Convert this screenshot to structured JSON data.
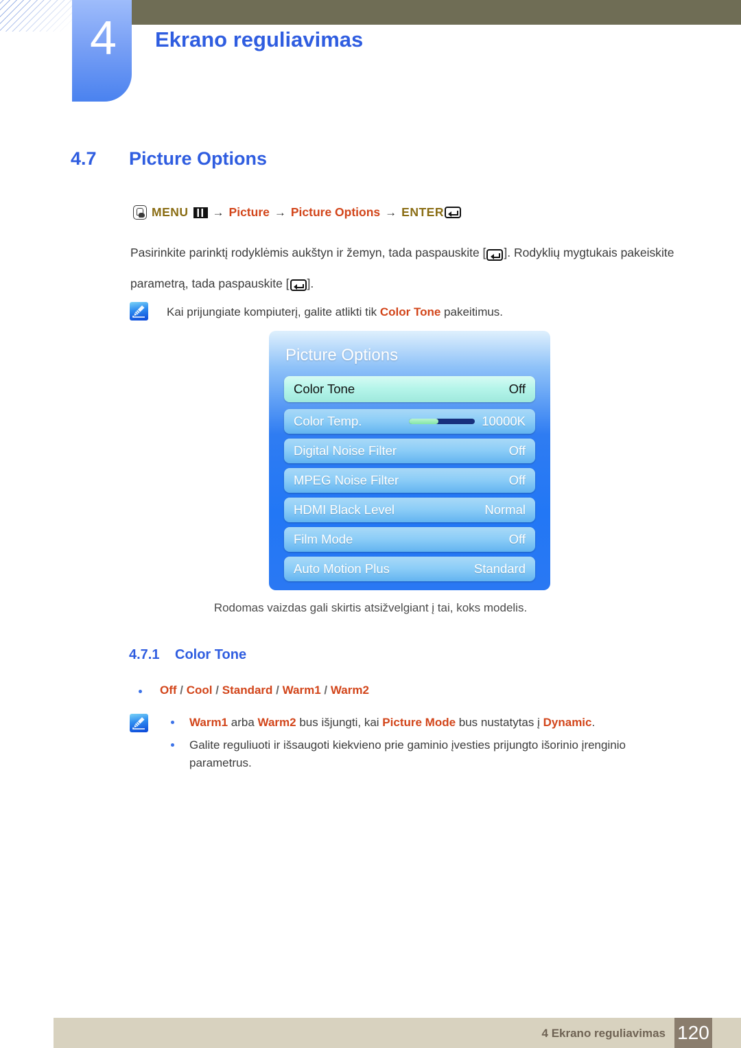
{
  "header": {
    "chapter_number": "4",
    "chapter_title": "Ekrano reguliavimas",
    "accent_blue": "#2f5de0",
    "tab_blue": "#79a0f5",
    "olive": "#6f6d55"
  },
  "section": {
    "number": "4.7",
    "title": "Picture Options"
  },
  "menu_path": {
    "menu_label": "MENU",
    "item1": "Picture",
    "item2": "Picture Options",
    "enter_label": "ENTER",
    "arrow": "→",
    "olive_color": "#8a6d14",
    "orange_color": "#d2451a"
  },
  "intro": {
    "line1_a": "Pasirinkite parinktį rodyklėmis aukštyn ir žemyn, tada paspauskite [",
    "line1_b": "]. Rodyklių mygtukais pakeiskite",
    "line2_a": "parametrą, tada paspauskite [",
    "line2_b": "]."
  },
  "note_top": {
    "text_a": "Kai prijungiate kompiuterį, galite atlikti tik ",
    "keyword": "Color Tone",
    "text_b": " pakeitimus."
  },
  "osd": {
    "title": "Picture Options",
    "rows": [
      {
        "label": "Color Tone",
        "value": "Off",
        "selected": true,
        "slider": null
      },
      {
        "label": "Color Temp.",
        "value": "10000K",
        "selected": false,
        "slider": 45
      },
      {
        "label": "Digital Noise Filter",
        "value": "Off",
        "selected": false,
        "slider": null
      },
      {
        "label": "MPEG Noise Filter",
        "value": "Off",
        "selected": false,
        "slider": null
      },
      {
        "label": "HDMI Black Level",
        "value": "Normal",
        "selected": false,
        "slider": null
      },
      {
        "label": "Film Mode",
        "value": "Off",
        "selected": false,
        "slider": null
      },
      {
        "label": "Auto Motion Plus",
        "value": "Standard",
        "selected": false,
        "slider": null
      }
    ]
  },
  "caption": "Rodomas vaizdas gali skirtis atsižvelgiant į tai, koks modelis.",
  "subsection": {
    "number": "4.7.1",
    "title": "Color Tone"
  },
  "options": {
    "items": [
      "Off",
      "Cool",
      "Standard",
      "Warm1",
      "Warm2"
    ],
    "separator": "/"
  },
  "notes_bottom": [
    {
      "parts": [
        {
          "t": "Warm1",
          "kw": true
        },
        {
          "t": " arba ",
          "kw": false
        },
        {
          "t": "Warm2",
          "kw": true
        },
        {
          "t": " bus išjungti, kai ",
          "kw": false
        },
        {
          "t": "Picture Mode",
          "kw": true
        },
        {
          "t": " bus nustatytas į ",
          "kw": false
        },
        {
          "t": "Dynamic",
          "kw": true
        },
        {
          "t": ".",
          "kw": false
        }
      ]
    },
    {
      "parts": [
        {
          "t": "Galite reguliuoti ir išsaugoti kiekvieno prie gaminio įvesties prijungto išorinio įrenginio parametrus.",
          "kw": false
        }
      ]
    }
  ],
  "footer": {
    "text": "4 Ekrano reguliavimas",
    "page": "120",
    "bar_color": "#d8d2bf",
    "page_box_color": "#8a7d6d"
  }
}
